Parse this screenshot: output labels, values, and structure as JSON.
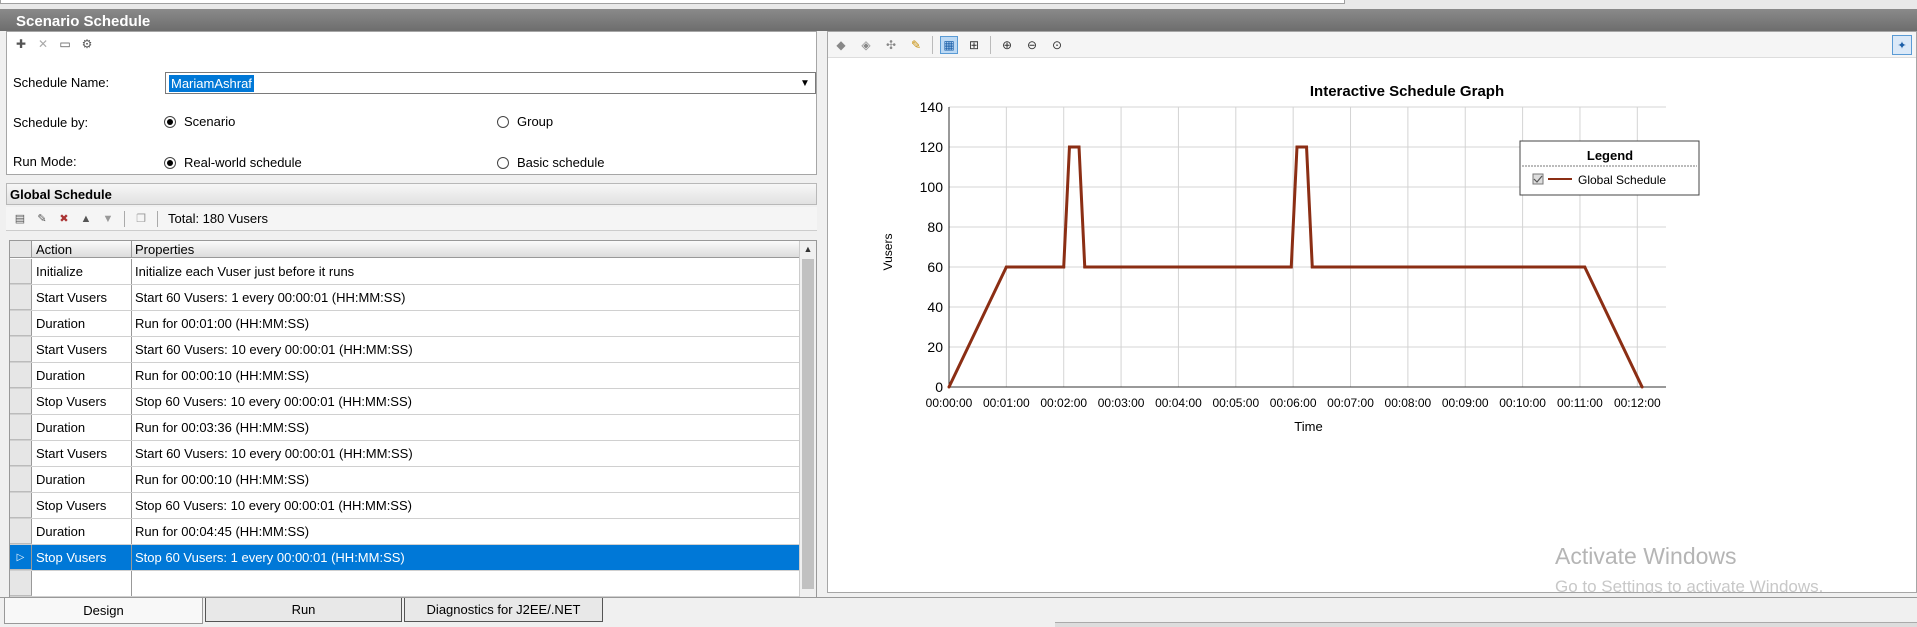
{
  "window": {
    "title": "Scenario Schedule"
  },
  "schedule_form": {
    "toolbar": [
      "new-schedule-icon",
      "delete-icon",
      "rename-icon",
      "schedule-settings-icon"
    ],
    "name_label": "Schedule Name:",
    "name_value": "MariamAshraf",
    "schedule_by_label": "Schedule by:",
    "schedule_by_options": [
      {
        "label": "Scenario",
        "selected": true
      },
      {
        "label": "Group",
        "selected": false
      }
    ],
    "run_mode_label": "Run Mode:",
    "run_mode_options": [
      {
        "label": "Real-world schedule",
        "selected": true
      },
      {
        "label": "Basic schedule",
        "selected": false
      }
    ]
  },
  "global_schedule": {
    "title": "Global Schedule",
    "total": "Total: 180 Vusers",
    "columns": [
      "Action",
      "Properties"
    ],
    "rows": [
      {
        "action": "Initialize",
        "properties": "Initialize each Vuser just before it runs"
      },
      {
        "action": "Start  Vusers",
        "properties": "Start 60 Vusers: 1 every 00:00:01 (HH:MM:SS)"
      },
      {
        "action": "Duration",
        "properties": "Run for 00:01:00 (HH:MM:SS)"
      },
      {
        "action": "Start  Vusers",
        "properties": "Start 60 Vusers: 10 every 00:00:01 (HH:MM:SS)"
      },
      {
        "action": "Duration",
        "properties": "Run for 00:00:10 (HH:MM:SS)"
      },
      {
        "action": "Stop Vusers",
        "properties": "Stop 60 Vusers: 10 every 00:00:01 (HH:MM:SS)"
      },
      {
        "action": "Duration",
        "properties": "Run for 00:03:36 (HH:MM:SS)"
      },
      {
        "action": "Start  Vusers",
        "properties": "Start 60 Vusers: 10 every 00:00:01 (HH:MM:SS)"
      },
      {
        "action": "Duration",
        "properties": "Run for 00:00:10 (HH:MM:SS)"
      },
      {
        "action": "Stop Vusers",
        "properties": "Stop 60 Vusers: 10 every 00:00:01 (HH:MM:SS)"
      },
      {
        "action": "Duration",
        "properties": "Run for 00:04:45 (HH:MM:SS)"
      },
      {
        "action": "Stop Vusers",
        "properties": "Stop 60 Vusers: 1 every 00:00:01 (HH:MM:SS)",
        "selected": true
      }
    ]
  },
  "chart_data": {
    "type": "line",
    "title": "Interactive Schedule Graph",
    "xlabel": "Time",
    "ylabel": "Vusers",
    "x_ticks": [
      "00:00:00",
      "00:01:00",
      "00:02:00",
      "00:03:00",
      "00:04:00",
      "00:05:00",
      "00:06:00",
      "00:07:00",
      "00:08:00",
      "00:09:00",
      "00:10:00",
      "00:11:00",
      "00:12:00"
    ],
    "y_ticks": [
      0,
      20,
      40,
      60,
      80,
      100,
      120,
      140
    ],
    "ylim": [
      0,
      140
    ],
    "xlim_seconds": [
      0,
      750
    ],
    "grid": true,
    "legend": {
      "title": "Legend",
      "position": "top-right"
    },
    "series": [
      {
        "name": "Global Schedule",
        "color": "#8b2e14",
        "points_seconds": [
          [
            0,
            0
          ],
          [
            60,
            60
          ],
          [
            120,
            60
          ],
          [
            126,
            120
          ],
          [
            136,
            120
          ],
          [
            142,
            60
          ],
          [
            358,
            60
          ],
          [
            364,
            120
          ],
          [
            374,
            120
          ],
          [
            380,
            60
          ],
          [
            665,
            60
          ],
          [
            725,
            0
          ]
        ]
      }
    ]
  },
  "graph_toolbar": [
    "select-icon",
    "select-all-icon",
    "split-icon",
    "edit-pencil-icon",
    "view-mode-icon",
    "fit-icon",
    "zoom-in-icon",
    "zoom-out-icon",
    "zoom-reset-icon",
    "pin-icon"
  ],
  "watermark": {
    "line1": "Activate Windows",
    "line2": "Go to Settings to activate Windows."
  },
  "tabs": [
    {
      "label": "Design",
      "active": true
    },
    {
      "label": "Run",
      "active": false
    },
    {
      "label": "Diagnostics for J2EE/.NET",
      "active": false
    }
  ]
}
